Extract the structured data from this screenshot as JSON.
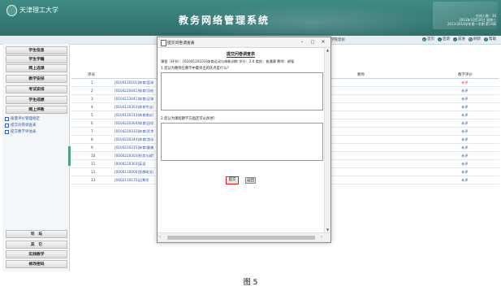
{
  "header": {
    "logo_text": "天津理工大学",
    "title": "教务网络管理系统",
    "info_lines": [
      "在线人数：36",
      "2013年10月30日 星期三",
      "2013-2014学年第一学期 第10周"
    ]
  },
  "topbar": {
    "location": "武汉学院您好",
    "links": [
      "首页",
      "后退",
      "前进",
      "刷新",
      "帮助"
    ]
  },
  "sidebar": {
    "menu_top": [
      "学生信息",
      "学生学籍",
      "网上选课",
      "教学安排",
      "考试安排",
      "学生成绩",
      "网上评教"
    ],
    "sub_items": [
      "质量评价管理规定",
      "提交问卷调查表",
      "提交教学评估表"
    ],
    "menu_bottom": [
      "论　坛",
      "其　它",
      "实践教学",
      "修改密码"
    ]
  },
  "table": {
    "headers": {
      "num": "序号",
      "teacher": "教师",
      "eval": "教学评价"
    },
    "rows": [
      {
        "num": "1",
        "course": "[0104120101]体育(篮球)",
        "status": "未评"
      },
      {
        "num": "2",
        "course": "[0104220441]体育(羽毛球)",
        "status": "未评"
      },
      {
        "num": "3",
        "course": "[0104123441]体育(足球)",
        "status": "未评"
      },
      {
        "num": "4",
        "course": "[0104120303]体育专业课",
        "status": "未评"
      },
      {
        "num": "5",
        "course": "[0104120313]体育理论课",
        "status": "未评"
      },
      {
        "num": "6",
        "course": "[0104220304]体育(田径)",
        "status": "未评"
      },
      {
        "num": "7",
        "course": "[0104220333]体育(武术)",
        "status": "未评"
      },
      {
        "num": "8",
        "course": "[0104220344]体育(游泳)",
        "status": "未评"
      },
      {
        "num": "9",
        "course": "[0104220315]体育(健美操)",
        "status": "未评"
      },
      {
        "num": "10",
        "course": "[0000220303]形势与政策",
        "status": "未评"
      },
      {
        "num": "11",
        "course": "[0000220303]英语",
        "status": "未评"
      },
      {
        "num": "12",
        "course": "[0000110000]思想政治课",
        "status": "未评"
      },
      {
        "num": "13",
        "course": "[0402110115]运筹学",
        "status": "未评"
      }
    ]
  },
  "dialog": {
    "window_title": "提交问卷调查表",
    "form_title": "提交问卷调查表",
    "course_info": "课程（环节）：[0104120103]体育运动与体能训练  学分：2.0  类别：普通课  教师：郝强",
    "q1": "1.您认为教师在教学中最突出的优点是什么？",
    "q2": "2.您认为课程教学方面还可以改进？",
    "submit_label": "提交",
    "return_label": "返回",
    "minimize": "–",
    "maximize": "□",
    "close": "×"
  },
  "caption": "图 5",
  "colors": {
    "header_bg": "#2f6f6b",
    "highlight_border": "#e0182a",
    "link": "#2c4fa0"
  }
}
